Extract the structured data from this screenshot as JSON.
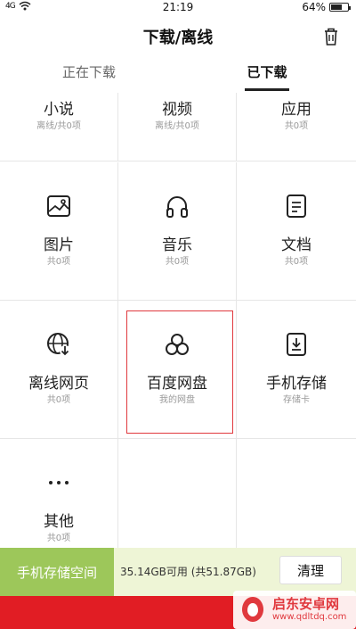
{
  "status_bar": {
    "signal": "4G",
    "time": "21:19",
    "battery": "64%",
    "battery_level": 0.64
  },
  "header": {
    "title": "下载/离线"
  },
  "tabs": [
    {
      "label": "正在下载",
      "active": false
    },
    {
      "label": "已下载",
      "active": true
    }
  ],
  "categories": [
    {
      "label": "小说",
      "sub": "离线/共0项"
    },
    {
      "label": "视频",
      "sub": "离线/共0项"
    },
    {
      "label": "应用",
      "sub": "共0项"
    },
    {
      "label": "图片",
      "sub": "共0项",
      "icon": "image-icon"
    },
    {
      "label": "音乐",
      "sub": "共0项",
      "icon": "headphones-icon"
    },
    {
      "label": "文档",
      "sub": "共0项",
      "icon": "document-icon"
    },
    {
      "label": "离线网页",
      "sub": "共0项",
      "icon": "offline-web-icon"
    },
    {
      "label": "百度网盘",
      "sub": "我的网盘",
      "icon": "cloud-disk-icon"
    },
    {
      "label": "手机存储",
      "sub": "存储卡",
      "icon": "phone-storage-icon"
    },
    {
      "label": "其他",
      "sub": "共0项",
      "icon": "more-icon"
    }
  ],
  "storage": {
    "label": "手机存储空间",
    "info": "35.14GB可用 (共51.87GB)",
    "clean_label": "清理"
  },
  "watermark": {
    "name": "启东安卓网",
    "url": "www.qdltdq.com"
  },
  "colors": {
    "accent_green": "#9dc75a",
    "banner_red": "#e11d24",
    "highlight_red": "#e0393e"
  }
}
